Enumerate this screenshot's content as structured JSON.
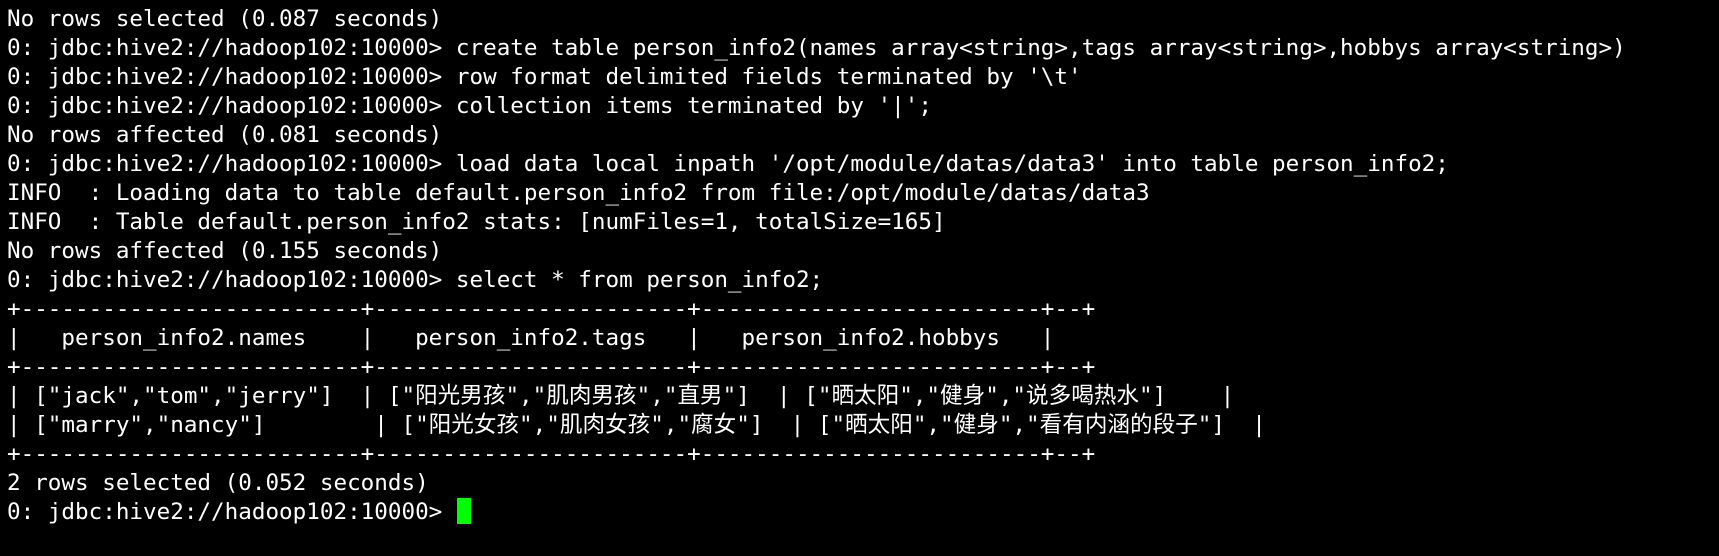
{
  "terminal": {
    "cursor_color": "#00ff00",
    "text_color": "#ffffff",
    "background_color": "#000000",
    "lines": [
      "No rows selected (0.087 seconds)",
      "0: jdbc:hive2://hadoop102:10000> create table person_info2(names array<string>,tags array<string>,hobbys array<string>)",
      "0: jdbc:hive2://hadoop102:10000> row format delimited fields terminated by '\\t'",
      "0: jdbc:hive2://hadoop102:10000> collection items terminated by '|';",
      "No rows affected (0.081 seconds)",
      "0: jdbc:hive2://hadoop102:10000> load data local inpath '/opt/module/datas/data3' into table person_info2;",
      "INFO  : Loading data to table default.person_info2 from file:/opt/module/datas/data3",
      "INFO  : Table default.person_info2 stats: [numFiles=1, totalSize=165]",
      "No rows affected (0.155 seconds)",
      "0: jdbc:hive2://hadoop102:10000> select * from person_info2;",
      "+-------------------------+-----------------------+-------------------------+--+",
      "|   person_info2.names    |   person_info2.tags   |   person_info2.hobbys   |",
      "+-------------------------+-----------------------+-------------------------+--+",
      "| [\"jack\",\"tom\",\"jerry\"]  | [\"阳光男孩\",\"肌肉男孩\",\"直男\"]  | [\"晒太阳\",\"健身\",\"说多喝热水\"]    |",
      "| [\"marry\",\"nancy\"]        | [\"阳光女孩\",\"肌肉女孩\",\"腐女\"]  | [\"晒太阳\",\"健身\",\"看有内涵的段子\"]  |",
      "+-------------------------+-----------------------+-------------------------+--+",
      "2 rows selected (0.052 seconds)"
    ],
    "prompt": "0: jdbc:hive2://hadoop102:10000> "
  }
}
